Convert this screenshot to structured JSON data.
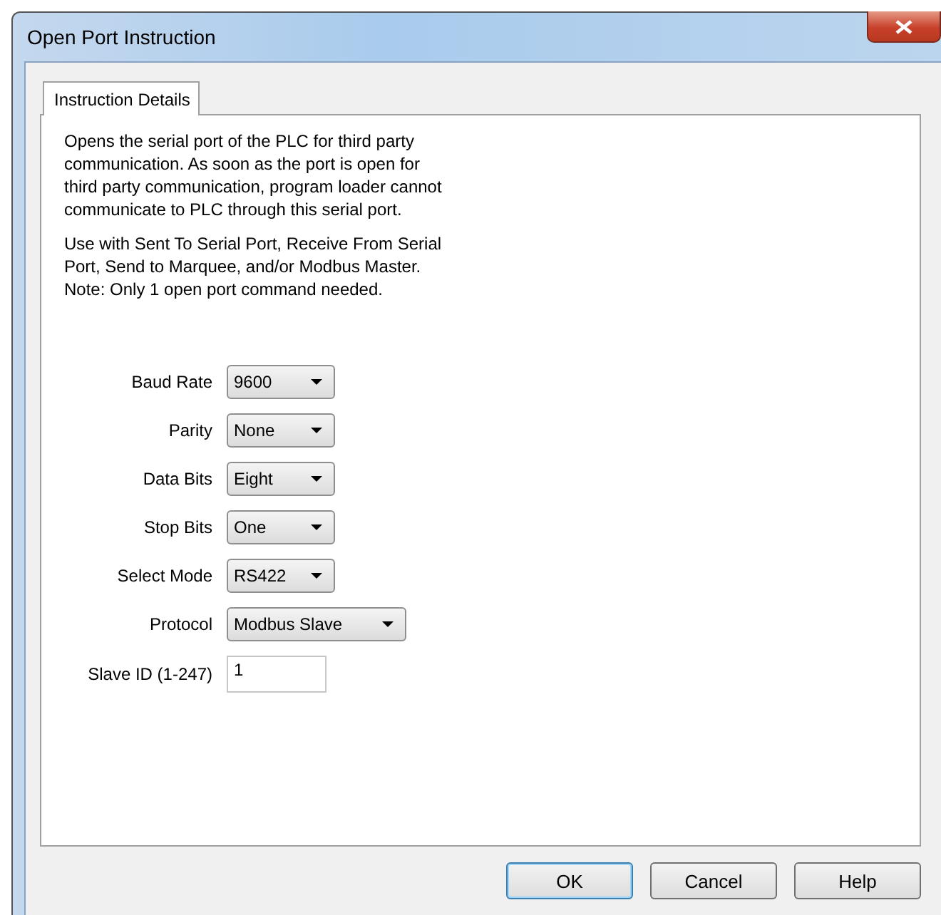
{
  "window": {
    "title": "Open Port Instruction"
  },
  "tabs": [
    {
      "label": "Instruction Details",
      "selected": true
    }
  ],
  "description": [
    "Opens the serial port of the PLC for third party communication. As soon as the port is open for third party communication, program loader cannot communicate to PLC through this serial port.",
    "Use with Sent To Serial Port, Receive From Serial Port, Send to Marquee, and/or Modbus Master.",
    "Note: Only 1 open port command needed."
  ],
  "fields": [
    {
      "kind": "select",
      "label": "Baud Rate",
      "value": "9600"
    },
    {
      "kind": "select",
      "label": "Parity",
      "value": "None"
    },
    {
      "kind": "select",
      "label": "Data Bits",
      "value": "Eight"
    },
    {
      "kind": "select",
      "label": "Stop Bits",
      "value": "One"
    },
    {
      "kind": "select",
      "label": "Select Mode",
      "value": "RS422"
    },
    {
      "kind": "wide-select",
      "label": "Protocol",
      "value": "Modbus Slave"
    },
    {
      "kind": "text",
      "label": "Slave ID (1-247)",
      "value": "1"
    }
  ],
  "buttons": [
    {
      "label": "OK",
      "default": true
    },
    {
      "label": "Cancel",
      "default": false
    },
    {
      "label": "Help",
      "default": false
    }
  ]
}
